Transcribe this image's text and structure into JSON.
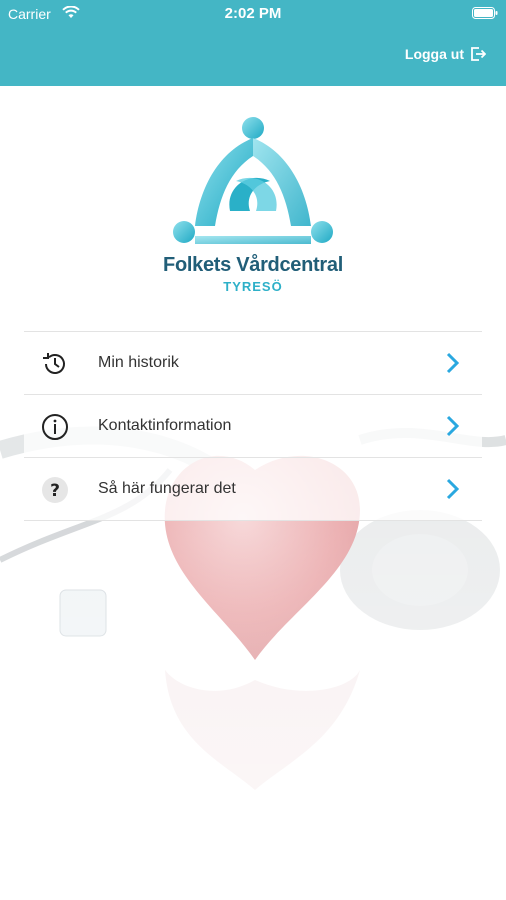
{
  "status_bar": {
    "carrier": "Carrier",
    "time": "2:02 PM"
  },
  "header": {
    "logout_label": "Logga ut",
    "background_color": "#44b6c5"
  },
  "logo": {
    "title": "Folkets Vårdcentral",
    "subtitle": "TYRESÖ"
  },
  "menu": {
    "items": [
      {
        "label": "Min historik",
        "icon": "history-icon"
      },
      {
        "label": "Kontaktinformation",
        "icon": "info-icon"
      },
      {
        "label": "Så här fungerar det",
        "icon": "question-icon"
      }
    ],
    "chevron_color": "#2aa8e0"
  }
}
